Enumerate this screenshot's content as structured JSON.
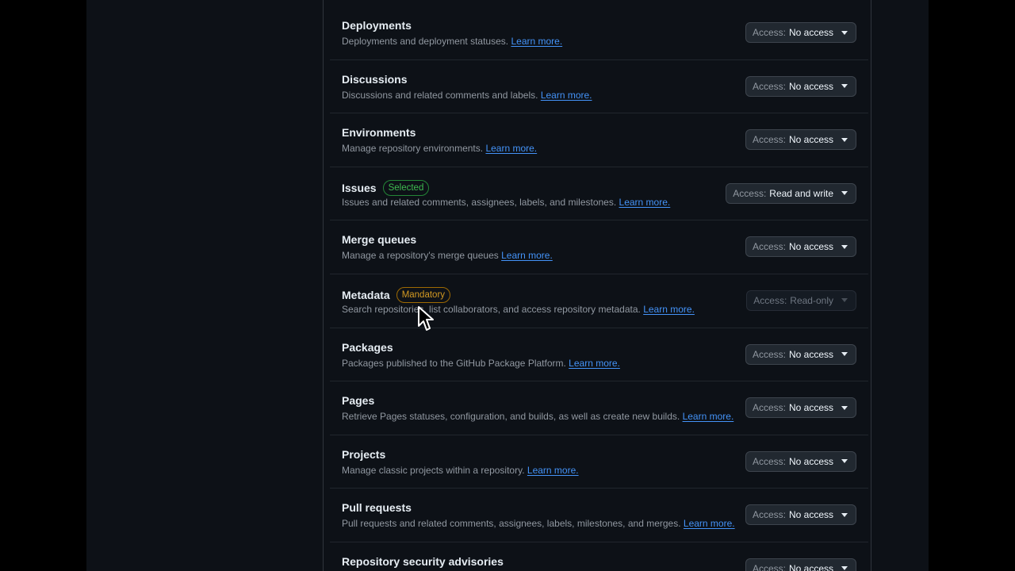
{
  "access_prefix": "Access:",
  "learn_more": "Learn more.",
  "permissions": [
    {
      "title": "Deployments",
      "description": "Deployments and deployment statuses.",
      "access": "No access",
      "badge": "",
      "disabled": false
    },
    {
      "title": "Discussions",
      "description": "Discussions and related comments and labels.",
      "access": "No access",
      "badge": "",
      "disabled": false
    },
    {
      "title": "Environments",
      "description": "Manage repository environments.",
      "access": "No access",
      "badge": "",
      "disabled": false
    },
    {
      "title": "Issues",
      "description": "Issues and related comments, assignees, labels, and milestones.",
      "access": "Read and write",
      "badge": "Selected",
      "badge_type": "selected",
      "disabled": false
    },
    {
      "title": "Merge queues",
      "description": "Manage a repository's merge queues",
      "access": "No access",
      "badge": "",
      "disabled": false
    },
    {
      "title": "Metadata",
      "description": "Search repositories, list collaborators, and access repository metadata.",
      "access": "Read-only",
      "badge": "Mandatory",
      "badge_type": "mandatory",
      "disabled": true
    },
    {
      "title": "Packages",
      "description": "Packages published to the GitHub Package Platform.",
      "access": "No access",
      "badge": "",
      "disabled": false
    },
    {
      "title": "Pages",
      "description": "Retrieve Pages statuses, configuration, and builds, as well as create new builds.",
      "access": "No access",
      "badge": "",
      "disabled": false
    },
    {
      "title": "Projects",
      "description": "Manage classic projects within a repository.",
      "access": "No access",
      "badge": "",
      "disabled": false
    },
    {
      "title": "Pull requests",
      "description": "Pull requests and related comments, assignees, labels, milestones, and merges.",
      "access": "No access",
      "badge": "",
      "disabled": false
    },
    {
      "title": "Repository security advisories",
      "description": "",
      "access": "No access",
      "badge": "",
      "disabled": false
    }
  ]
}
